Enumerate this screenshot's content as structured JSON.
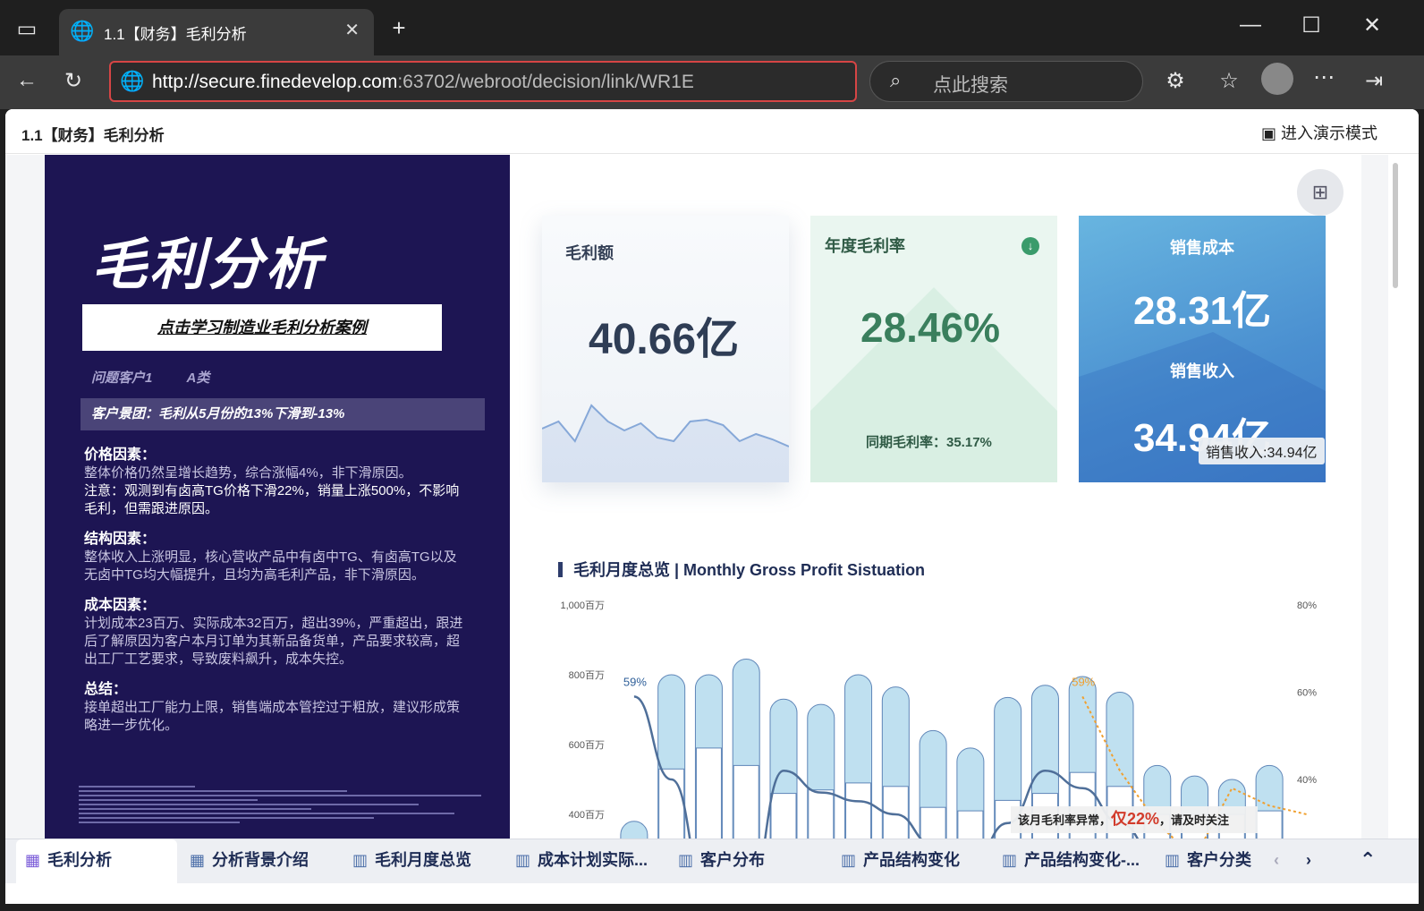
{
  "browser": {
    "tab_title": "1.1【财务】毛利分析",
    "url_host": "http://secure.finedevelop.com",
    "url_rest": ":63702/webroot/decision/link/WR1E",
    "search_placeholder": "点此搜索"
  },
  "report": {
    "title": "1.1【财务】毛利分析",
    "present_label": "进入演示模式"
  },
  "left_panel": {
    "big_title": "毛利分析",
    "learn_button": "点击学习制造业毛利分析案例",
    "tag1": "问题客户1",
    "tag2": "A类",
    "group_line": "客户景团：毛利从5月份的13%下滑到-13%",
    "sections": [
      {
        "head": "价格因素：",
        "body": "整体价格仍然呈增长趋势，综合涨幅4%，非下滑原因。",
        "note": "注意：观测到有卤高TG价格下滑22%，销量上涨500%，不影响毛利，但需跟进原因。"
      },
      {
        "head": "结构因素：",
        "body": "整体收入上涨明显，核心营收产品中有卤中TG、有卤高TG以及无卤中TG均大幅提升，且均为高毛利产品，非下滑原因。"
      },
      {
        "head": "成本因素：",
        "body": "计划成本23百万、实际成本32百万，超出39%，严重超出，跟进后了解原因为客户本月订单为其新品备货单，产品要求较高，超出工厂工艺要求，导致废料飙升，成本失控。"
      },
      {
        "head": "总结：",
        "body": "接单超出工厂能力上限，销售端成本管控过于粗放，建议形成策略进一步优化。"
      }
    ]
  },
  "kpi": {
    "gross_label": "毛利额",
    "gross_value": "40.66亿",
    "rate_label": "年度毛利率",
    "rate_value": "28.46%",
    "rate_prev": "同期毛利率：35.17%",
    "cost_label": "销售成本",
    "cost_value": "28.31亿",
    "income_label": "销售收入",
    "income_value": "34.94亿",
    "tooltip": "销售收入:34.94亿"
  },
  "section": {
    "title": "毛利月度总览",
    "subtitle": "Monthly Gross Profit Sistuation"
  },
  "chart_data": {
    "type": "bar",
    "y_left_ticks": [
      "1,000百万",
      "800百万",
      "600百万",
      "400百万"
    ],
    "y_right_ticks": [
      "80%",
      "60%",
      "40%"
    ],
    "ylim": [
      0,
      1000
    ],
    "y2lim": [
      0,
      80
    ],
    "series": [
      {
        "kind": "bar",
        "values": [
          380,
          800,
          800,
          845,
          730,
          715,
          800,
          765,
          640,
          590,
          735,
          770,
          795,
          750,
          540,
          510,
          500,
          540
        ]
      },
      {
        "kind": "bar-inner",
        "values": [
          0,
          530,
          590,
          540,
          460,
          470,
          490,
          480,
          420,
          410,
          440,
          460,
          520,
          480,
          400,
          400,
          400,
          410
        ]
      },
      {
        "kind": "line",
        "values": [
          59,
          40,
          12,
          10,
          42,
          37,
          35,
          32,
          25,
          20,
          30,
          42,
          38,
          30,
          22,
          18,
          20,
          22
        ]
      },
      {
        "kind": "line-dashed",
        "values": [
          59,
          42,
          30,
          22,
          38,
          34,
          32
        ]
      }
    ],
    "labels": {
      "start": "59%",
      "peak": "59%",
      "end": "22%"
    },
    "annotation_prefix": "该月毛利率异常，",
    "annotation_value": "仅22%",
    "annotation_suffix": "，请及时关注",
    "sparkline": [
      32,
      40,
      18,
      58,
      40,
      30,
      38,
      22,
      18,
      40,
      42,
      36,
      18,
      26,
      20,
      12
    ]
  },
  "bottom_tabs": [
    {
      "label": "毛利分析"
    },
    {
      "label": "分析背景介绍"
    },
    {
      "label": "毛利月度总览"
    },
    {
      "label": "成本计划实际..."
    },
    {
      "label": "客户分布"
    },
    {
      "label": "产品结构变化"
    },
    {
      "label": "产品结构变化-..."
    },
    {
      "label": "客户分类"
    }
  ]
}
